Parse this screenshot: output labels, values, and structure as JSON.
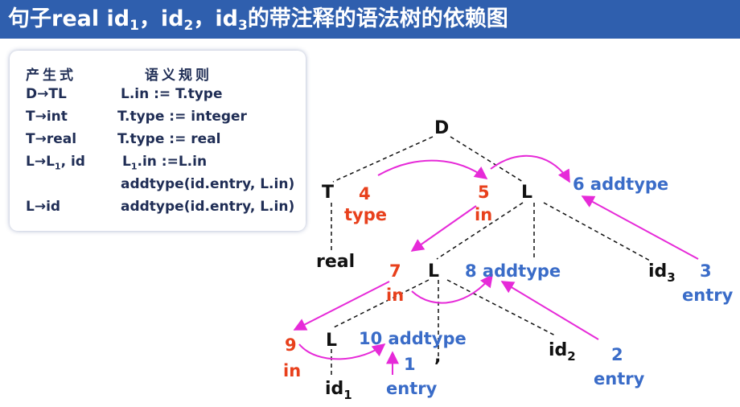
{
  "title": {
    "part1": "句子real  id",
    "sub1": "1",
    "part2": "，id",
    "sub2": "2",
    "part3": "，id",
    "sub3": "3",
    "part4": "的带注释的语法树的依赖图"
  },
  "rules": {
    "header_prod": "产生式",
    "header_sem": "语义规则",
    "rows": [
      {
        "prod": "D→TL",
        "sem": "L.in := T.type"
      },
      {
        "prod": "T→int",
        "sem": "T.type := integer"
      },
      {
        "prod": "T→real",
        "sem": "T.type := real"
      },
      {
        "prod_a": "L→L",
        "prod_sub": "1",
        "prod_b": ", id",
        "sem_a": "L",
        "sem_sub": "1",
        "sem_b": ".in :=L.in"
      },
      {
        "prod": "",
        "sem": "addtype(id.entry, L.in)"
      },
      {
        "prod": "L→id",
        "sem": "addtype(id.entry, L.in)"
      }
    ]
  },
  "tree": {
    "nodes": {
      "D": "D",
      "T": "T",
      "L1": "L",
      "real": "real",
      "L2": "L",
      "id3": "id",
      "id3_sub": "3",
      "L3": "L",
      "id2": "id",
      "id2_sub": "2",
      "comma": ",",
      "id1": "id",
      "id1_sub": "1"
    },
    "annotations": {
      "n4": "4",
      "n4_label": "type",
      "n5": "5",
      "n5_label": "in",
      "n6": "6  addtype",
      "n3": "3",
      "n3_label": "entry",
      "n7": "7",
      "n7_label": "in",
      "n8": "8 addtype",
      "n2": "2",
      "n2_label": "entry",
      "n9": "9",
      "n9_label": "in",
      "n10": "10  addtype",
      "n1": "1",
      "n1_label": "entry"
    }
  },
  "colors": {
    "title_bg": "#2f5fae",
    "arrow": "#e62ad8",
    "red_text": "#e8401c",
    "blue_text": "#3a6cc8"
  }
}
